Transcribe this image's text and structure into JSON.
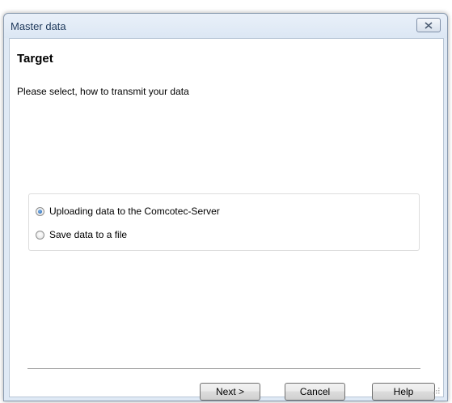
{
  "window": {
    "title": "Master data"
  },
  "page": {
    "heading": "Target",
    "instruction": "Please select, how to transmit your data"
  },
  "options": [
    {
      "label": "Uploading data to the Comcotec-Server",
      "selected": true
    },
    {
      "label": "Save data to a file",
      "selected": false
    }
  ],
  "buttons": {
    "next": "Next >",
    "cancel": "Cancel",
    "help": "Help"
  },
  "icons": {
    "close": "close-icon",
    "radio_selected": "radio-selected-icon",
    "radio_unselected": "radio-unselected-icon",
    "size_grip": "resize-grip-icon"
  }
}
